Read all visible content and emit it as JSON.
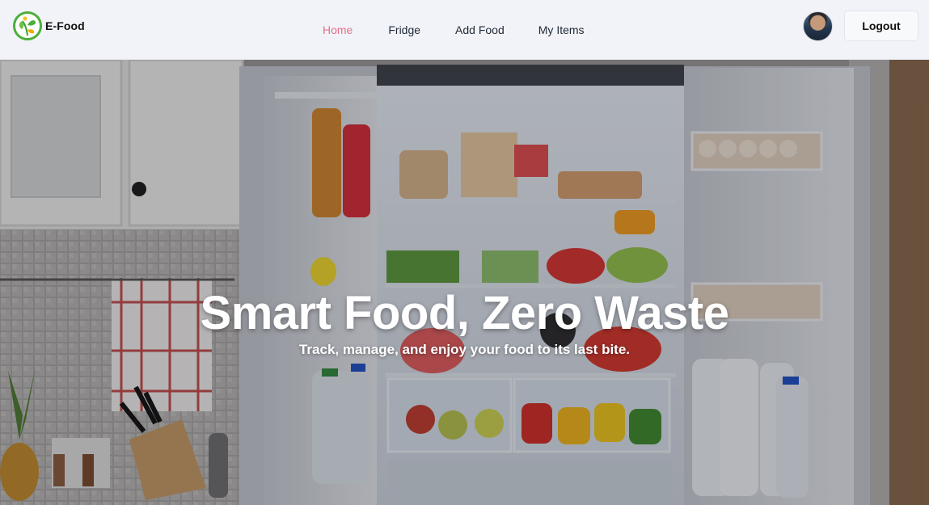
{
  "brand": {
    "name": "E-Food",
    "logo_icon": "leaf-logo-icon"
  },
  "nav": {
    "items": [
      {
        "label": "Home",
        "active": true
      },
      {
        "label": "Fridge",
        "active": false
      },
      {
        "label": "Add Food",
        "active": false
      },
      {
        "label": "My Items",
        "active": false
      }
    ]
  },
  "user": {
    "avatar_icon": "user-avatar",
    "logout_label": "Logout"
  },
  "hero": {
    "title": "Smart Food, Zero Waste",
    "subtitle": "Track, manage, and enjoy your food to its last bite."
  },
  "colors": {
    "active_nav": "#e76f8a",
    "navbar_bg": "#f1f3f8",
    "logo_green": "#4caf3a"
  }
}
